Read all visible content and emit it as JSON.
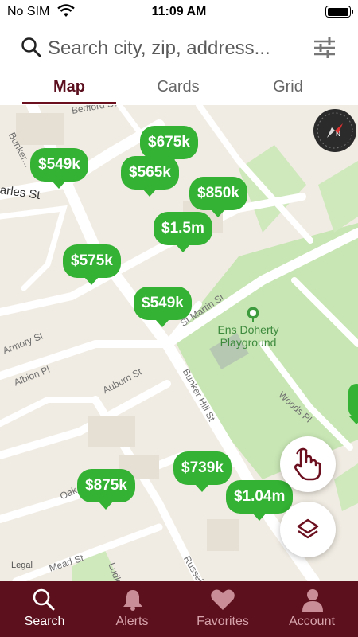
{
  "status_bar": {
    "carrier": "No SIM",
    "time": "11:09 AM",
    "battery_level": 0.9
  },
  "search": {
    "placeholder": "Search city, zip, address..."
  },
  "view_tabs": [
    {
      "label": "Map",
      "active": true
    },
    {
      "label": "Cards",
      "active": false
    },
    {
      "label": "Grid",
      "active": false
    }
  ],
  "map": {
    "price_pins": [
      "$675k",
      "$549k",
      "$565k",
      "$850k",
      "$1.5m",
      "$575k",
      "$549k",
      "$739k",
      "$875k",
      "$1.04m"
    ],
    "park_name": "Ens Doherty Playground",
    "streets": [
      "Bedford St",
      "Bunker...",
      "arles St",
      "St Martin St",
      "Armory St",
      "Albion Pl",
      "Auburn St",
      "Bunker Hill St",
      "Woods Pl",
      "Oak",
      "Mead St",
      "Ludlo",
      "Russel"
    ],
    "legal": "Legal"
  },
  "bottom_tabs": [
    {
      "label": "Search",
      "icon": "search-icon",
      "active": true
    },
    {
      "label": "Alerts",
      "icon": "bell-icon",
      "active": false
    },
    {
      "label": "Favorites",
      "icon": "heart-icon",
      "active": false
    },
    {
      "label": "Account",
      "icon": "person-icon",
      "active": false
    }
  ],
  "colors": {
    "brand": "#5c0f1d",
    "pin": "#33b233",
    "park": "#c8e6b4"
  }
}
